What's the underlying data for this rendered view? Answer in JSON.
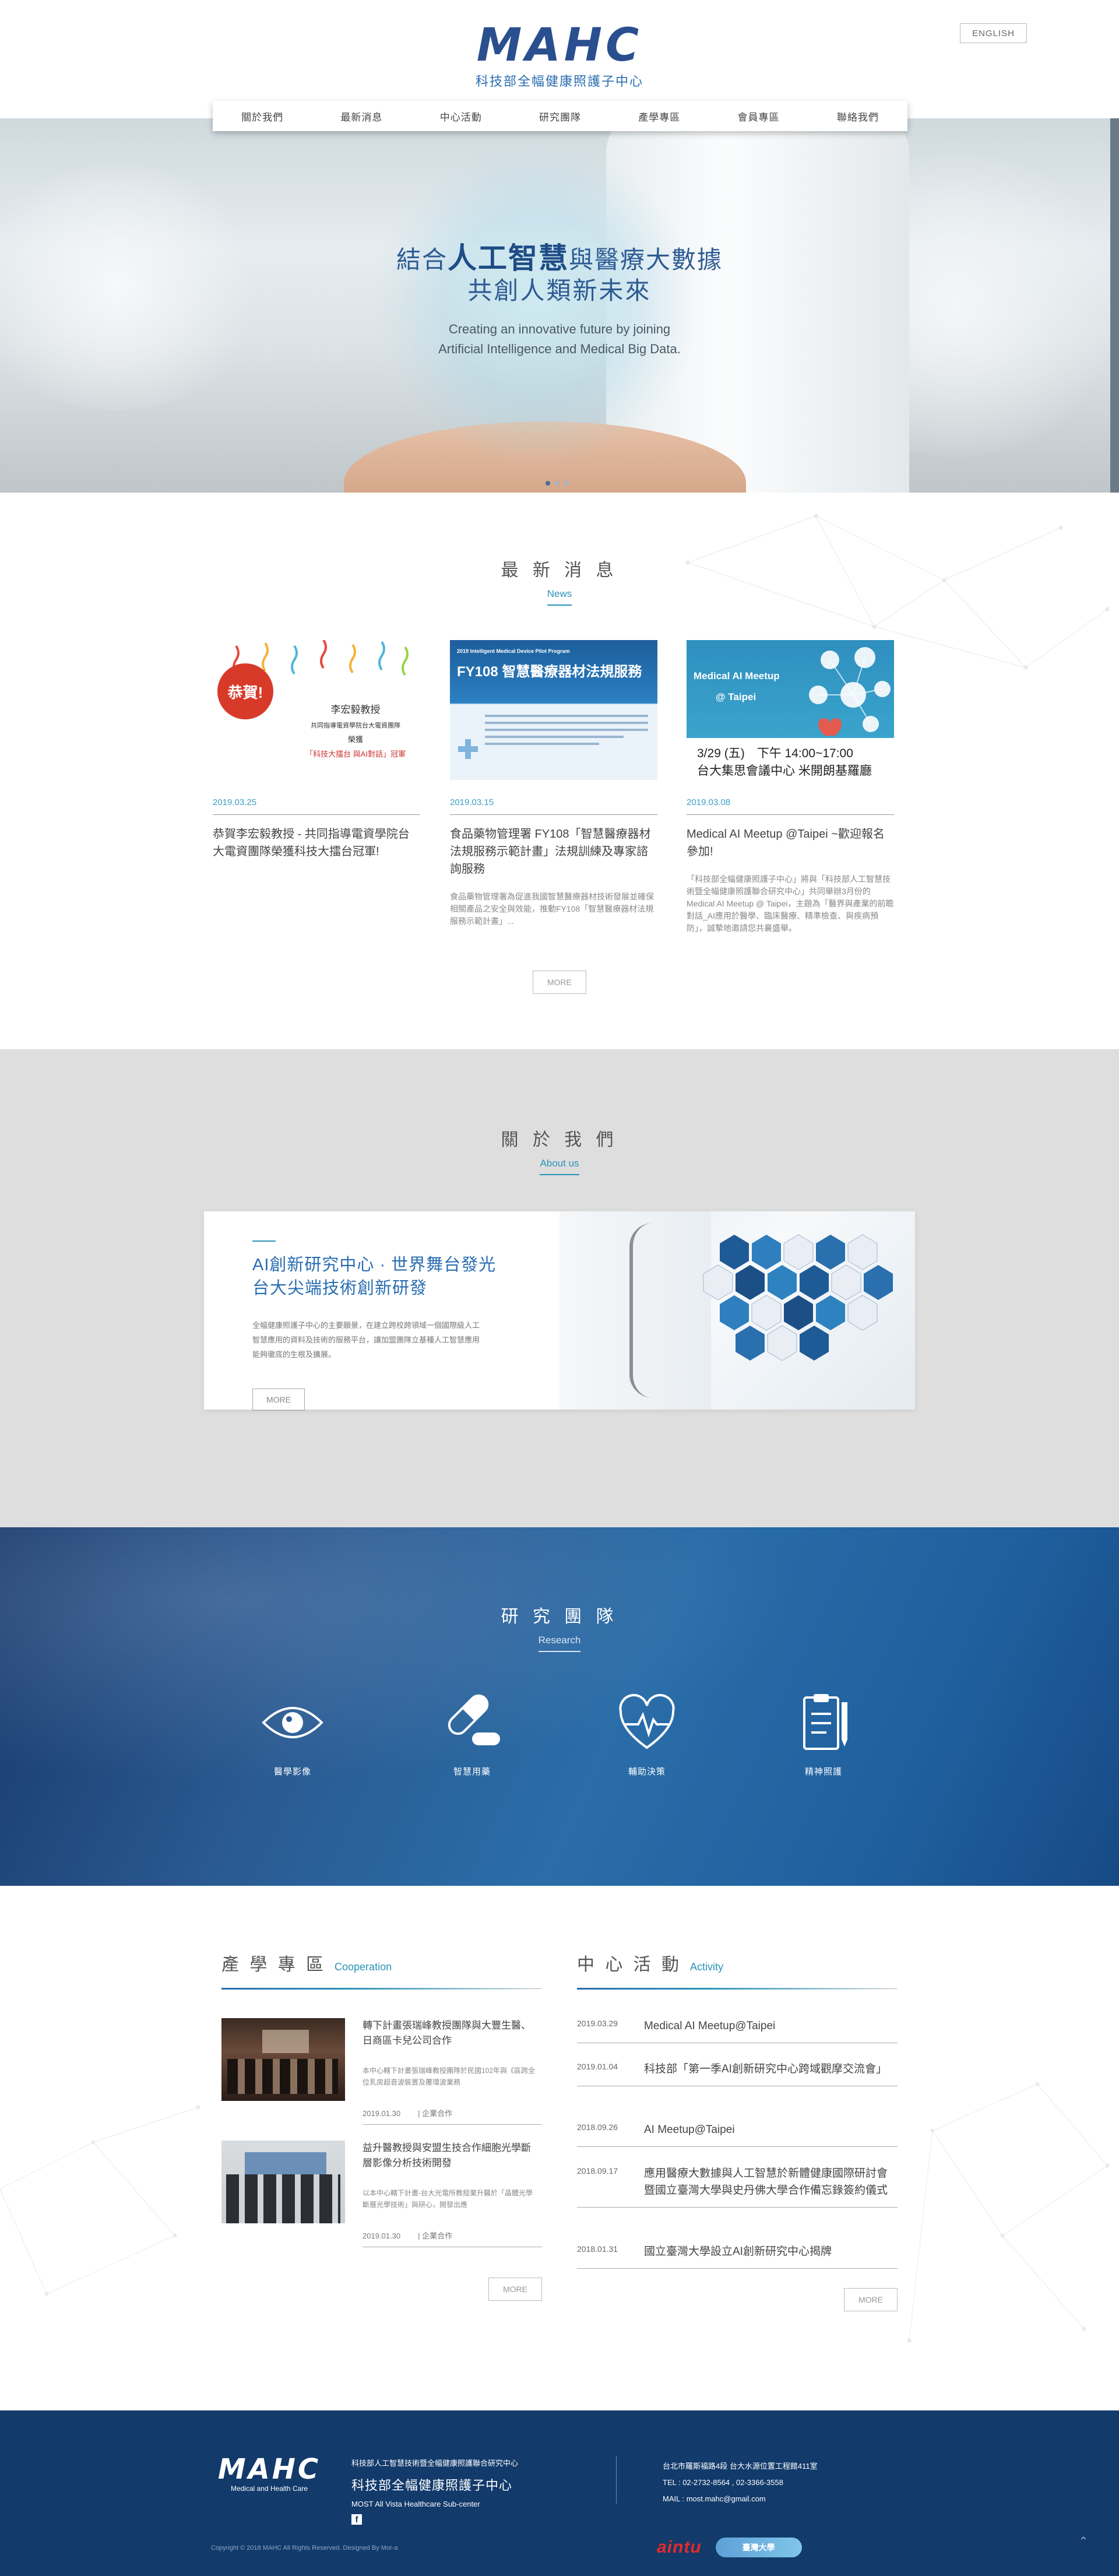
{
  "header": {
    "logo_mark": "MAHC",
    "logo_sub": "科技部全幅健康照護子中心",
    "lang": "ENGLISH"
  },
  "nav": [
    "關於我們",
    "最新消息",
    "中心活動",
    "研究團隊",
    "產學專區",
    "會員專區",
    "聯絡我們"
  ],
  "hero": {
    "line1_a": "結合",
    "line1_b": "人工智慧",
    "line1_c": "與醫療大數據",
    "line2": "共創人類新未來",
    "line3": "Creating an innovative future by joining",
    "line4": "Artificial Intelligence and Medical Big Data.",
    "slide_count": 3,
    "active_slide": 1
  },
  "news": {
    "title": "最 新 消 息",
    "subtitle": "News",
    "more": "MORE",
    "items": [
      {
        "date": "2019.03.25",
        "title": "恭賀李宏毅教授 - 共同指導電資學院台大電資團隊榮獲科技大擂台冠軍!",
        "desc": "",
        "img_badge": "恭賀!",
        "img_name": "李宏毅教授",
        "img_line1": "共同指導電資學院台大電資團隊",
        "img_line2": "榮獲",
        "img_line3": "「科技大擂台 與AI對話」冠軍"
      },
      {
        "date": "2019.03.15",
        "title": "食品藥物管理署 FY108「智慧醫療器材法規服務示範計畫」法規訓練及專家諮詢服務",
        "desc": "食品藥物管理署為促進我國智慧醫療器材技術發展並確保相關產品之安全與效能，推動FY108「智慧醫療器材法規服務示範計畫」...",
        "img_small": "2019 Intelligent Medical Device Pilot Program",
        "img_big": "FY108 智慧醫療器材法規服務"
      },
      {
        "date": "2019.03.08",
        "title": "Medical AI Meetup @Taipei ~歡迎報名參加!",
        "desc": "「科技部全幅健康照護子中心」將與「科技部人工智慧技術暨全幅健康照護聯合研究中心」共同舉辦3月份的Medical AI Meetup @ Taipei，主題為「醫界與產業的前瞻對話_AI應用於醫學、臨床醫療、精準檢查、與疾病預防」，誠摯地邀請您共襄盛舉。",
        "img_title": "Medical AI Meetup",
        "img_sub": "@ Taipei",
        "img_line1": "3/29 (五)　下午 14:00~17:00",
        "img_line2": "台大集思會議中心 米開朗基羅廳"
      }
    ]
  },
  "about": {
    "title": "關 於 我 們",
    "subtitle": "About us",
    "heading1": "AI創新研究中心 · 世界舞台發光",
    "heading2": "台大尖端技術創新研發",
    "body": "全幅健康照護子中心的主要願景，在建立跨校跨領域一個國際級人工智慧應用的資料及技術的服務平台，讓加盟團隊立基種人工智慧應用能夠徹底的生根及擴展。",
    "more": "MORE"
  },
  "research": {
    "title": "研 究 團 隊",
    "subtitle": "Research",
    "items": [
      {
        "label": "醫學影像",
        "icon": "eye-icon"
      },
      {
        "label": "智慧用藥",
        "icon": "pill-icon"
      },
      {
        "label": "輔助決策",
        "icon": "heartbeat-icon"
      },
      {
        "label": "精神照護",
        "icon": "clipboard-icon"
      }
    ]
  },
  "cooperation": {
    "title": "產 學 專 區",
    "subtitle": "Cooperation",
    "more": "MORE",
    "items": [
      {
        "title": "轉下計畫張瑞峰教授團隊與大豐生醫、日商區卡兒公司合作",
        "desc": "本中心轄下計畫張瑞峰教授團隊於民國102年與《區跨全位乳房超音波裝置及覆環波業務",
        "date": "2019.01.30",
        "cat": "| 企業合作"
      },
      {
        "title": "益升醫教授與安盟生技合作細胞光學斷層影像分析技術開發",
        "desc": "以本中心轄下計畫-台大光電所教授業升醫於「晶體光學斷層光學技術」與研心，開發出應",
        "date": "2019.01.30",
        "cat": "| 企業合作"
      }
    ]
  },
  "activity": {
    "title": "中 心 活 動",
    "subtitle": "Activity",
    "more": "MORE",
    "items": [
      {
        "date": "2019.03.29",
        "title": "Medical AI Meetup@Taipei"
      },
      {
        "date": "2019.01.04",
        "title": "科技部「第一季AI創新研究中心跨域觀摩交流會」"
      },
      {
        "date": "2018.09.26",
        "title": "AI Meetup@Taipei"
      },
      {
        "date": "2018.09.17",
        "title": "應用醫療大數據與人工智慧於新體健康國際研討會 暨國立臺灣大學與史丹佛大學合作備忘錄簽約儀式"
      },
      {
        "date": "2018.01.31",
        "title": "國立臺灣大學設立AI創新研究中心揭牌"
      }
    ]
  },
  "footer": {
    "logo_mark": "MAHC",
    "logo_sub": "Medical and Health Care",
    "org_line": "科技部人工智慧技術暨全幅健康照護聯合研究中心",
    "org_name": "科技部全幅健康照護子中心",
    "org_en": "MOST All Vista Healthcare Sub-center",
    "address": "台北市羅斯福路4段 台大水源位置工程館411室",
    "tel": "TEL : 02-2732-8564 , 02-3366-3558",
    "mail": "MAIL : most.mahc@gmail.com",
    "copyright": "Copyright © 2018 MAHC All Rights Reserved. Designed By Mor-a",
    "partner1": "aintu",
    "partner2": "臺灣大學"
  }
}
